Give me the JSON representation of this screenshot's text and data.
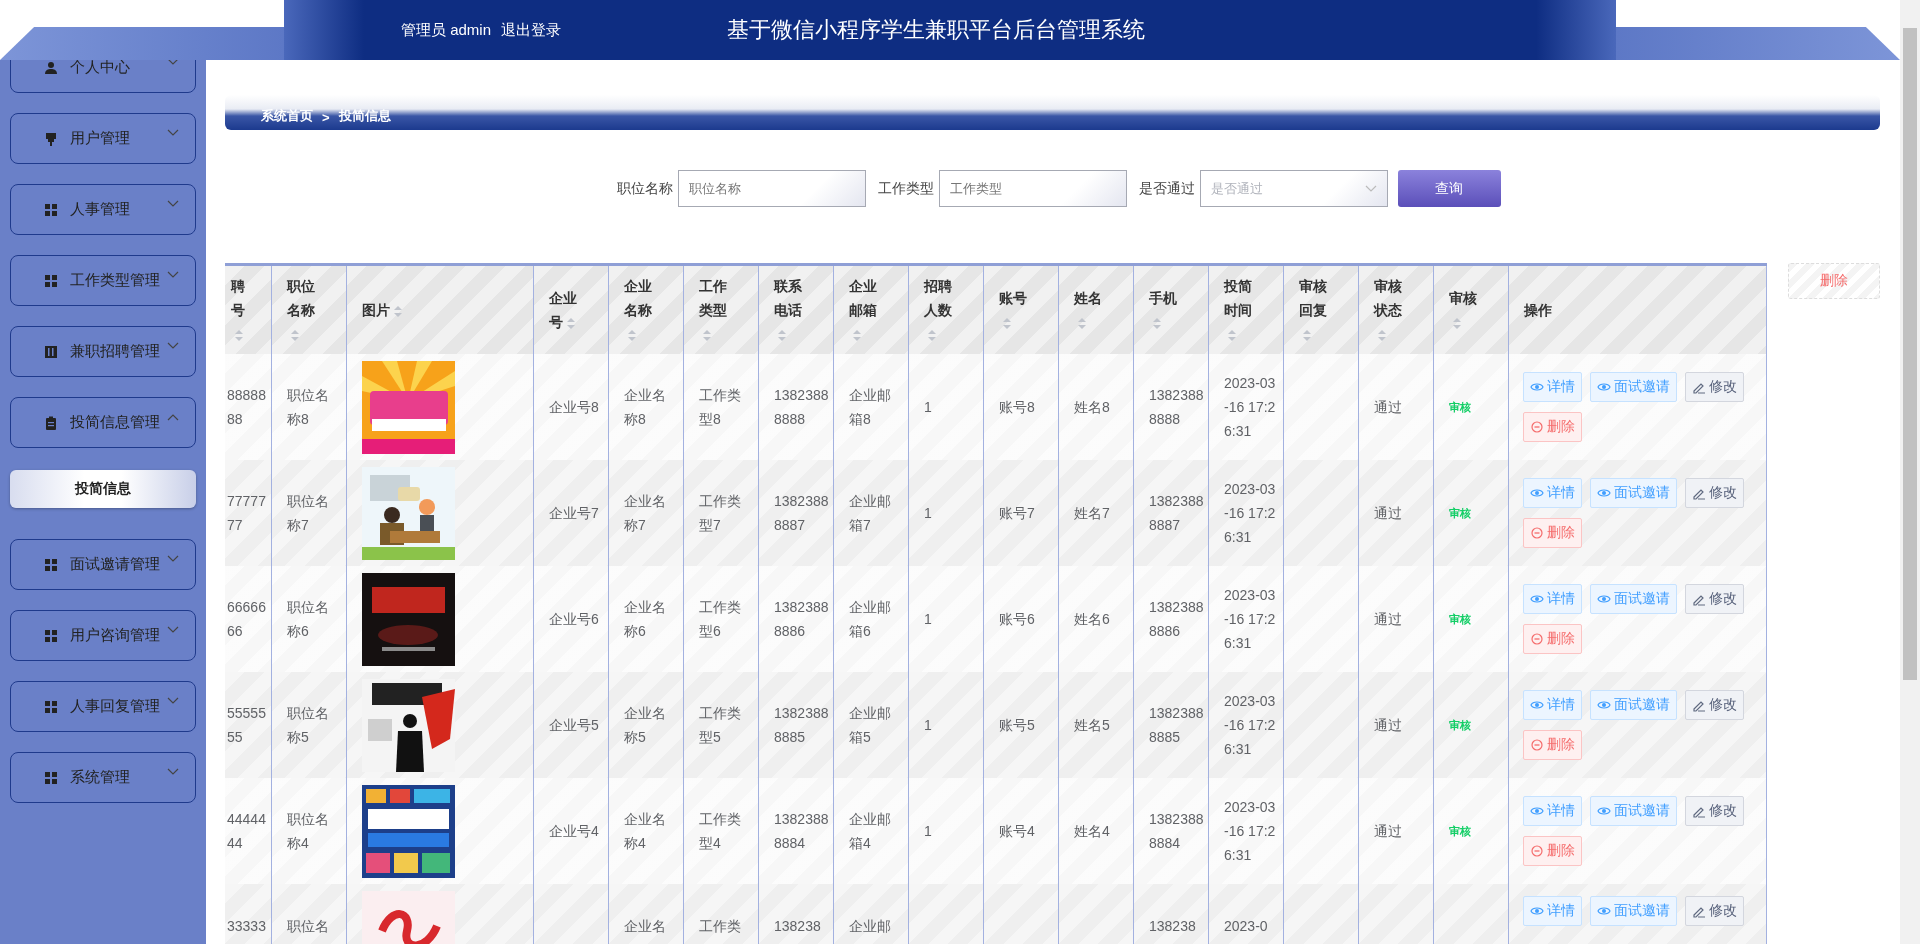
{
  "header": {
    "user": "管理员 admin",
    "logout": "退出登录",
    "title": "基于微信小程序学生兼职平台后台管理系统"
  },
  "sidebar": {
    "items": [
      {
        "label": "个人中心",
        "expanded": false
      },
      {
        "label": "用户管理",
        "expanded": false
      },
      {
        "label": "人事管理",
        "expanded": false
      },
      {
        "label": "工作类型管理",
        "expanded": false
      },
      {
        "label": "兼职招聘管理",
        "expanded": false
      },
      {
        "label": "投简信息管理",
        "expanded": true,
        "children": [
          {
            "label": "投简信息",
            "selected": true
          }
        ]
      },
      {
        "label": "面试邀请管理",
        "expanded": false
      },
      {
        "label": "用户咨询管理",
        "expanded": false
      },
      {
        "label": "人事回复管理",
        "expanded": false
      },
      {
        "label": "系统管理",
        "expanded": false
      }
    ]
  },
  "breadcrumb": {
    "home": "系统首页",
    "separator": ">",
    "current": "投简信息"
  },
  "search": {
    "fields": [
      {
        "label": "职位名称",
        "placeholder": "职位名称",
        "kind": "input"
      },
      {
        "label": "工作类型",
        "placeholder": "工作类型",
        "kind": "input"
      },
      {
        "label": "是否通过",
        "placeholder": "是否通过",
        "kind": "select"
      }
    ],
    "button": "查询"
  },
  "batch_delete": "删除",
  "table": {
    "columns": [
      {
        "label": "聘号",
        "sortable": true
      },
      {
        "label": "职位名称",
        "sortable": true
      },
      {
        "label": "图片",
        "sortable": true
      },
      {
        "label": "企业号",
        "sortable": true
      },
      {
        "label": "企业名称",
        "sortable": true
      },
      {
        "label": "工作类型",
        "sortable": true
      },
      {
        "label": "联系电话",
        "sortable": true
      },
      {
        "label": "企业邮箱",
        "sortable": true
      },
      {
        "label": "招聘人数",
        "sortable": true
      },
      {
        "label": "账号",
        "sortable": true
      },
      {
        "label": "姓名",
        "sortable": true
      },
      {
        "label": "手机",
        "sortable": true
      },
      {
        "label": "投简时间",
        "sortable": true
      },
      {
        "label": "审核回复",
        "sortable": true
      },
      {
        "label": "审核状态",
        "sortable": true
      },
      {
        "label": "审核",
        "sortable": true
      },
      {
        "label": "操作",
        "sortable": false
      }
    ],
    "rows": [
      {
        "id": "8888888",
        "position": "职位名称8",
        "image": {
          "kind": "picture"
        },
        "company_no": "企业号8",
        "company_name": "企业名称8",
        "work_type": "工作类型8",
        "phone": "13823888888",
        "email": "企业邮箱8",
        "headcount": "1",
        "account": "账号8",
        "name": "姓名8",
        "mobile": "13823888888",
        "time": "2023-03-16 17:26:31",
        "status": "通过",
        "review": "审核",
        "actions": [
          {
            "label": "详情",
            "kind": "view"
          },
          {
            "label": "面试邀请",
            "kind": "view"
          },
          {
            "label": "修改",
            "kind": "edit"
          },
          {
            "label": "删除",
            "kind": "delete"
          }
        ]
      },
      {
        "id": "7777777",
        "position": "职位名称7",
        "image": {
          "kind": "picture"
        },
        "company_no": "企业号7",
        "company_name": "企业名称7",
        "work_type": "工作类型7",
        "phone": "13823888887",
        "email": "企业邮箱7",
        "headcount": "1",
        "account": "账号7",
        "name": "姓名7",
        "mobile": "13823888887",
        "time": "2023-03-16 17:26:31",
        "status": "通过",
        "review": "审核",
        "actions": [
          {
            "label": "详情",
            "kind": "view"
          },
          {
            "label": "面试邀请",
            "kind": "view"
          },
          {
            "label": "修改",
            "kind": "edit"
          },
          {
            "label": "删除",
            "kind": "delete"
          }
        ]
      },
      {
        "id": "6666666",
        "position": "职位名称6",
        "image": {
          "kind": "picture"
        },
        "company_no": "企业号6",
        "company_name": "企业名称6",
        "work_type": "工作类型6",
        "phone": "13823888886",
        "email": "企业邮箱6",
        "headcount": "1",
        "account": "账号6",
        "name": "姓名6",
        "mobile": "13823888886",
        "time": "2023-03-16 17:26:31",
        "status": "通过",
        "review": "审核",
        "actions": [
          {
            "label": "详情",
            "kind": "view"
          },
          {
            "label": "面试邀请",
            "kind": "view"
          },
          {
            "label": "修改",
            "kind": "edit"
          },
          {
            "label": "删除",
            "kind": "delete"
          }
        ]
      },
      {
        "id": "5555555",
        "position": "职位名称5",
        "image": {
          "kind": "picture"
        },
        "company_no": "企业号5",
        "company_name": "企业名称5",
        "work_type": "工作类型5",
        "phone": "13823888885",
        "email": "企业邮箱5",
        "headcount": "1",
        "account": "账号5",
        "name": "姓名5",
        "mobile": "13823888885",
        "time": "2023-03-16 17:26:31",
        "status": "通过",
        "review": "审核",
        "actions": [
          {
            "label": "详情",
            "kind": "view"
          },
          {
            "label": "面试邀请",
            "kind": "view"
          },
          {
            "label": "修改",
            "kind": "edit"
          },
          {
            "label": "删除",
            "kind": "delete"
          }
        ]
      },
      {
        "id": "4444444",
        "position": "职位名称4",
        "image": {
          "kind": "picture"
        },
        "company_no": "企业号4",
        "company_name": "企业名称4",
        "work_type": "工作类型4",
        "phone": "13823888884",
        "email": "企业邮箱4",
        "headcount": "1",
        "account": "账号4",
        "name": "姓名4",
        "mobile": "13823888884",
        "time": "2023-03-16 17:26:31",
        "status": "通过",
        "review": "审核",
        "actions": [
          {
            "label": "详情",
            "kind": "view"
          },
          {
            "label": "面试邀请",
            "kind": "view"
          },
          {
            "label": "修改",
            "kind": "edit"
          },
          {
            "label": "删除",
            "kind": "delete"
          }
        ]
      },
      {
        "id": "33333",
        "position": "职位名",
        "image": {
          "kind": "picture"
        },
        "company_name": "企业名",
        "work_type": "工作类",
        "phone": "138238",
        "email": "企业邮",
        "mobile": "138238",
        "time": "2023-0",
        "actions": [
          {
            "label": "详情",
            "kind": "view"
          },
          {
            "label": "面试邀请",
            "kind": "view"
          },
          {
            "label": "修改",
            "kind": "edit"
          }
        ]
      }
    ]
  }
}
